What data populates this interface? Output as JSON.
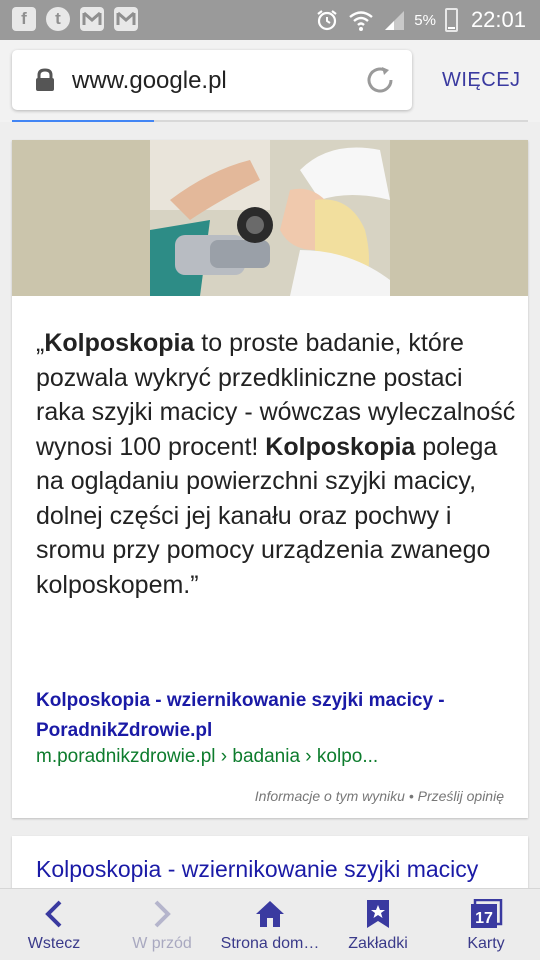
{
  "status_bar": {
    "left_icons": [
      "facebook-icon",
      "tumblr-icon",
      "gmail-icon",
      "gmail-icon"
    ],
    "battery": "5%",
    "time": "22:01"
  },
  "browser": {
    "url": "www.google.pl",
    "more_label": "WIĘCEJ"
  },
  "result": {
    "quote_open": "„",
    "term_1": "Kolposkopia",
    "text_1": " to proste badanie, które pozwala wykryć przedkliniczne postaci raka szyjki macicy - wówczas wyleczalność wynosi 100 procent! ",
    "term_2": "Kolposkopia",
    "text_2": " polega na oglądaniu powierzchni szyjki macicy, dolnej części jej kanału oraz pochwy i sromu przy pomocy urządzenia zwanego kolposkopem.”",
    "title": "Kolposkopia - wziernikowanie szyjki macicy - PoradnikZdrowie.pl",
    "url": "m.poradnikzdrowie.pl › badania › kolpo...",
    "info": "Informacje o tym wyniku • Prześlij opinię"
  },
  "next_result": {
    "title": "Kolposkopia - wziernikowanie szyjki macicy"
  },
  "bottom_nav": {
    "back": "Wstecz",
    "forward": "W przód",
    "home": "Strona dom…",
    "bookmarks": "Zakładki",
    "tabs": "Karty",
    "tab_count": "17"
  },
  "colors": {
    "link": "#1a1aa6",
    "url_green": "#0d7c2d",
    "accent": "#3a3aa0",
    "status_bar": "#9a9a9a"
  }
}
